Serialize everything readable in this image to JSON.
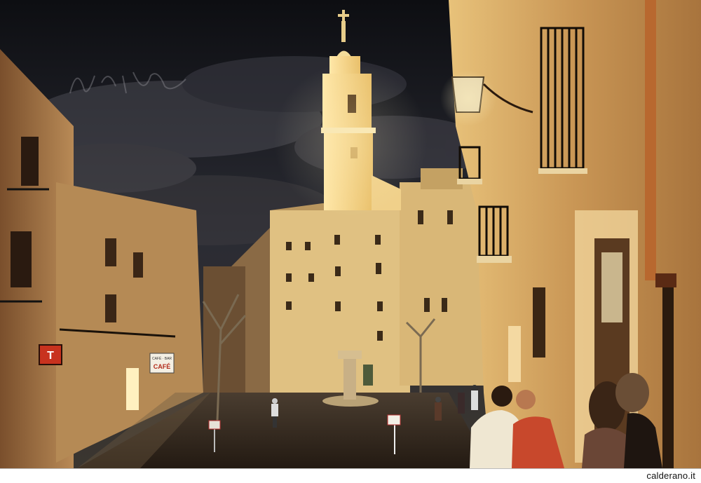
{
  "photo": {
    "description_icon": "night-town-square-photo",
    "signs": {
      "left_wall_sign": "T",
      "cafe_sign_top": "CAFÉ · BAR",
      "cafe_sign_main": "CAFÉ"
    },
    "signature_text": "signature",
    "colors": {
      "sky": "#15161c",
      "tower": "#f3dc9a",
      "wall_lit": "#e6b866",
      "wall_shadow": "#5a3a22"
    }
  },
  "footer": {
    "credit": "calderano.it"
  }
}
